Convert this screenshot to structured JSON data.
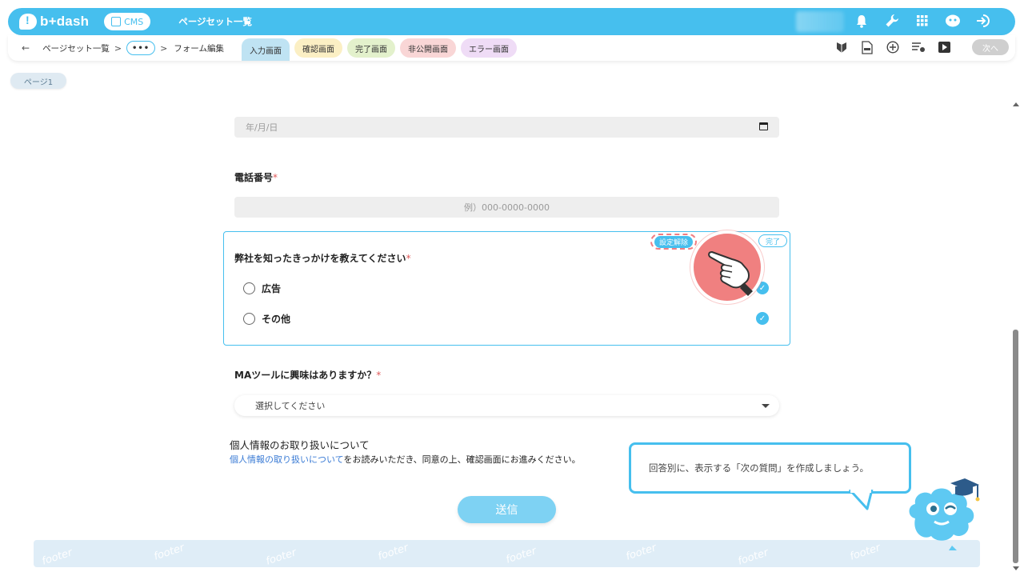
{
  "header": {
    "logo_text": "b+dash",
    "cms_label": "CMS",
    "title": "ページセット一覧",
    "icons": [
      "bell-icon",
      "wrench-icon",
      "grid-icon",
      "support-icon",
      "logout-icon"
    ]
  },
  "toolbar": {
    "back": "←",
    "crumb1": "ページセット一覧",
    "sep": ">",
    "ellipsis": "•••",
    "crumb2": "フォーム編集",
    "tabs": [
      "入力画面",
      "確認画面",
      "完了画面",
      "非公開画面",
      "エラー画面"
    ],
    "icons": [
      "shield-icon",
      "file-html-icon",
      "plus-circle-icon",
      "list-settings-icon",
      "play-icon"
    ],
    "next_label": "次へ"
  },
  "page_chip": "ページ1",
  "form": {
    "date_placeholder": "年/月/日",
    "phone_label": "電話番号",
    "phone_placeholder": "例）000-0000-0000",
    "question_label": "弊社を知ったきっかけを教えてください",
    "options": [
      "広告",
      "その他"
    ],
    "settings_badge": "設定解除",
    "done_badge": "完了",
    "ma_label": "MAツールに興味はありますか？",
    "select_placeholder": "選択してください",
    "required_mark": "*",
    "privacy_title": "個人情報のお取り扱いについて",
    "privacy_link": "個人情報の取り扱いについて",
    "privacy_rest": "をお読みいただき、同意の上、確認画面にお進みください。",
    "submit_label": "送信"
  },
  "footer_word": "footer",
  "bubble_text": "回答別に、表示する「次の質問」を作成しましょう。",
  "colors": {
    "accent": "#46bfee",
    "required": "#e05a5a",
    "pointer": "#f08080",
    "link": "#3a7bd5"
  }
}
